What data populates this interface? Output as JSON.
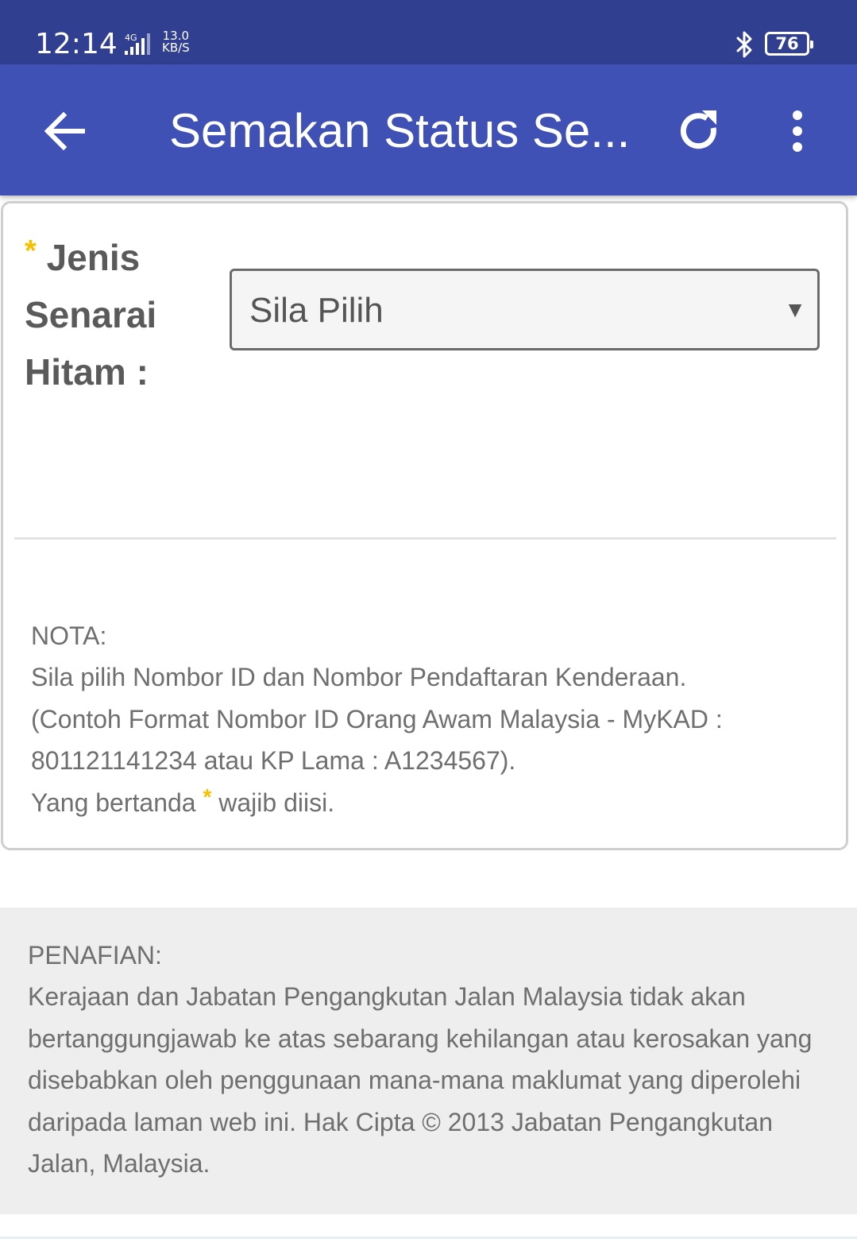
{
  "status_bar": {
    "time": "12:14",
    "network_type": "4G",
    "speed_value": "13.0",
    "speed_unit": "KB/S",
    "battery": "76",
    "icons": [
      "signal-icon",
      "bluetooth-icon",
      "battery-icon"
    ]
  },
  "app_bar": {
    "title": "Semakan Status Se...",
    "icons": [
      "back-arrow-icon",
      "refresh-icon",
      "more-vert-icon"
    ],
    "color": "#3f51b5"
  },
  "form": {
    "required_marker": "*",
    "field_label": "Jenis Senarai Hitam :",
    "select_value": "Sila Pilih",
    "select_caret": "▼"
  },
  "note": {
    "heading": "NOTA:",
    "line1": "Sila pilih Nombor ID dan Nombor Pendaftaran Kenderaan.",
    "line2": "(Contoh Format Nombor ID Orang Awam Malaysia - MyKAD : 801121141234 atau KP Lama : A1234567).",
    "required_prefix": "Yang bertanda",
    "required_marker": "*",
    "required_suffix": "wajib diisi."
  },
  "disclaimer": {
    "heading": "PENAFIAN:",
    "text": "Kerajaan dan Jabatan Pengangkutan Jalan Malaysia tidak akan bertanggungjawab ke atas sebarang kehilangan atau kerosakan yang disebabkan oleh penggunaan mana-mana maklumat yang diperolehi daripada laman web ini. Hak Cipta © 2013 Jabatan Pengangkutan Jalan, Malaysia."
  },
  "colors": {
    "status_bar": "#303f8f",
    "app_bar": "#3f51b5",
    "required_star": "#f5c000"
  }
}
